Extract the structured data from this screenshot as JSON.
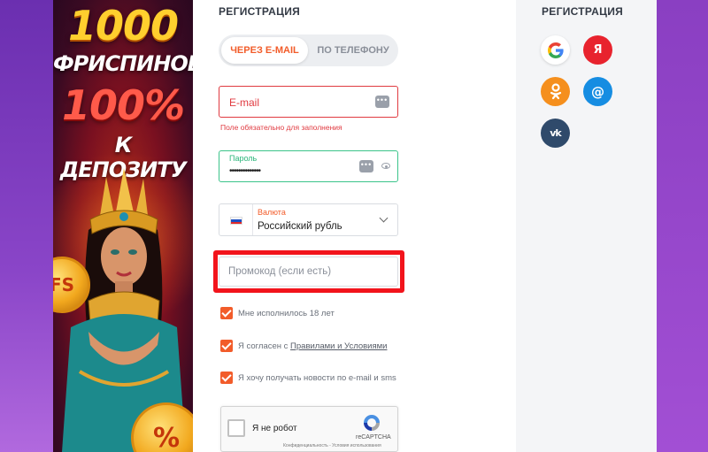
{
  "banner": {
    "line1": "1000",
    "line2": "ФРИСПИНОВ",
    "line3": "100%",
    "line4": "К ДЕПОЗИТУ",
    "coin1": "FS",
    "coin2": "%"
  },
  "form": {
    "title": "РЕГИСТРАЦИЯ",
    "tabs": [
      {
        "label": "ЧЕРЕЗ E-MAIL",
        "active": true
      },
      {
        "label": "ПО ТЕЛЕФОНУ",
        "active": false
      }
    ],
    "email": {
      "placeholder": "E-mail",
      "error": "Поле обязательно для заполнения"
    },
    "password": {
      "label": "Пароль",
      "value": "••••••••••••••"
    },
    "currency": {
      "label": "Валюта",
      "value": "Российский рубль"
    },
    "promo": {
      "placeholder": "Промокод (если есть)"
    },
    "checks": {
      "age": "Мне исполнилось 18 лет",
      "terms_prefix": "Я согласен с",
      "terms_link": "Правилами и Условиями",
      "news": "Я хочу получать новости по e-mail и sms"
    },
    "captcha": {
      "label": "Я не робот",
      "brand": "reCAPTCHA",
      "links": "Конфиденциальность - Условия использования"
    }
  },
  "social": {
    "title": "РЕГИСТРАЦИЯ",
    "buttons": [
      {
        "name": "google",
        "glyph": "G",
        "color": "#ffffff"
      },
      {
        "name": "yandex",
        "glyph": "Я",
        "color": "#e8232e"
      },
      {
        "name": "odnoklassniki",
        "glyph": "ok",
        "color": "#f58f1d"
      },
      {
        "name": "mail-ru",
        "glyph": "@",
        "color": "#168de2"
      },
      {
        "name": "vk",
        "glyph": "vk",
        "color": "#2f4a6b"
      }
    ]
  },
  "colors": {
    "accent": "#f25c2a",
    "error": "#e03a40",
    "success": "#3bc48a",
    "highlight": "#f2141c"
  }
}
